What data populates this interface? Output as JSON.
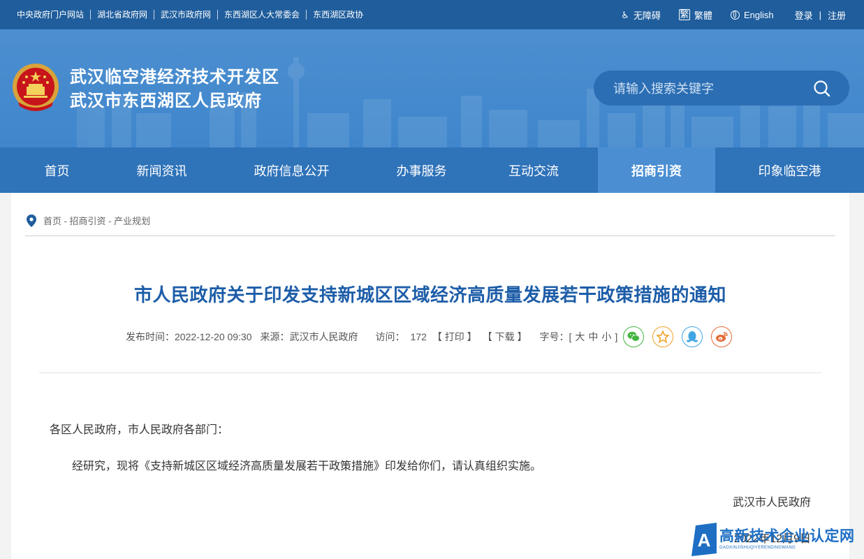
{
  "topbar": {
    "links": [
      "中央政府门户网站",
      "湖北省政府网",
      "武汉市政府网",
      "东西湖区人大常委会",
      "东西湖区政协"
    ],
    "accessibility": "无障碍",
    "traditional": "繁體",
    "english": "English",
    "login": "登录",
    "separator": "|",
    "register": "注册"
  },
  "banner": {
    "title_line1": "武汉临空港经济技术开发区",
    "title_line2": "武汉市东西湖区人民政府",
    "search_placeholder": "请输入搜索关键字"
  },
  "nav": {
    "items": [
      {
        "label": "首页"
      },
      {
        "label": "新闻资讯"
      },
      {
        "label": "政府信息公开"
      },
      {
        "label": "办事服务"
      },
      {
        "label": "互动交流"
      },
      {
        "label": "招商引资"
      },
      {
        "label": "印象临空港"
      }
    ],
    "active": "招商引资"
  },
  "breadcrumb": "首页 - 招商引资 - 产业规划",
  "article": {
    "title": "市人民政府关于印发支持新城区区域经济高质量发展若干政策措施的通知",
    "publish_label": "发布时间：",
    "publish_time": "2022-12-20 09:30",
    "source_label": "来源：",
    "source": "武汉市人民政府",
    "visits_label": "访问：",
    "visits": "172",
    "print": "【 打印 】",
    "download": "【 下载 】",
    "font_size_label": "字号：",
    "font_size_open": "[",
    "font_large": "大",
    "font_medium": "中",
    "font_small": "小",
    "font_size_close": "]",
    "greeting": "各区人民政府，市人民政府各部门：",
    "paragraph": "经研究，现将《支持新城区区域经济高质量发展若干政策措施》印发给你们，请认真组织实施。",
    "signature": "武汉市人民政府",
    "date": "2022年12月9日"
  },
  "watermark": {
    "main": "高新技术企业认定网",
    "sub": "GAOXINJISHUQIYERENDINGWANG"
  },
  "colors": {
    "topbar": "#1f5d9c",
    "banner": "#4a8ccf",
    "nav": "#2f73b9",
    "nav_active": "#4b8fd2",
    "title": "#1d5da8"
  }
}
